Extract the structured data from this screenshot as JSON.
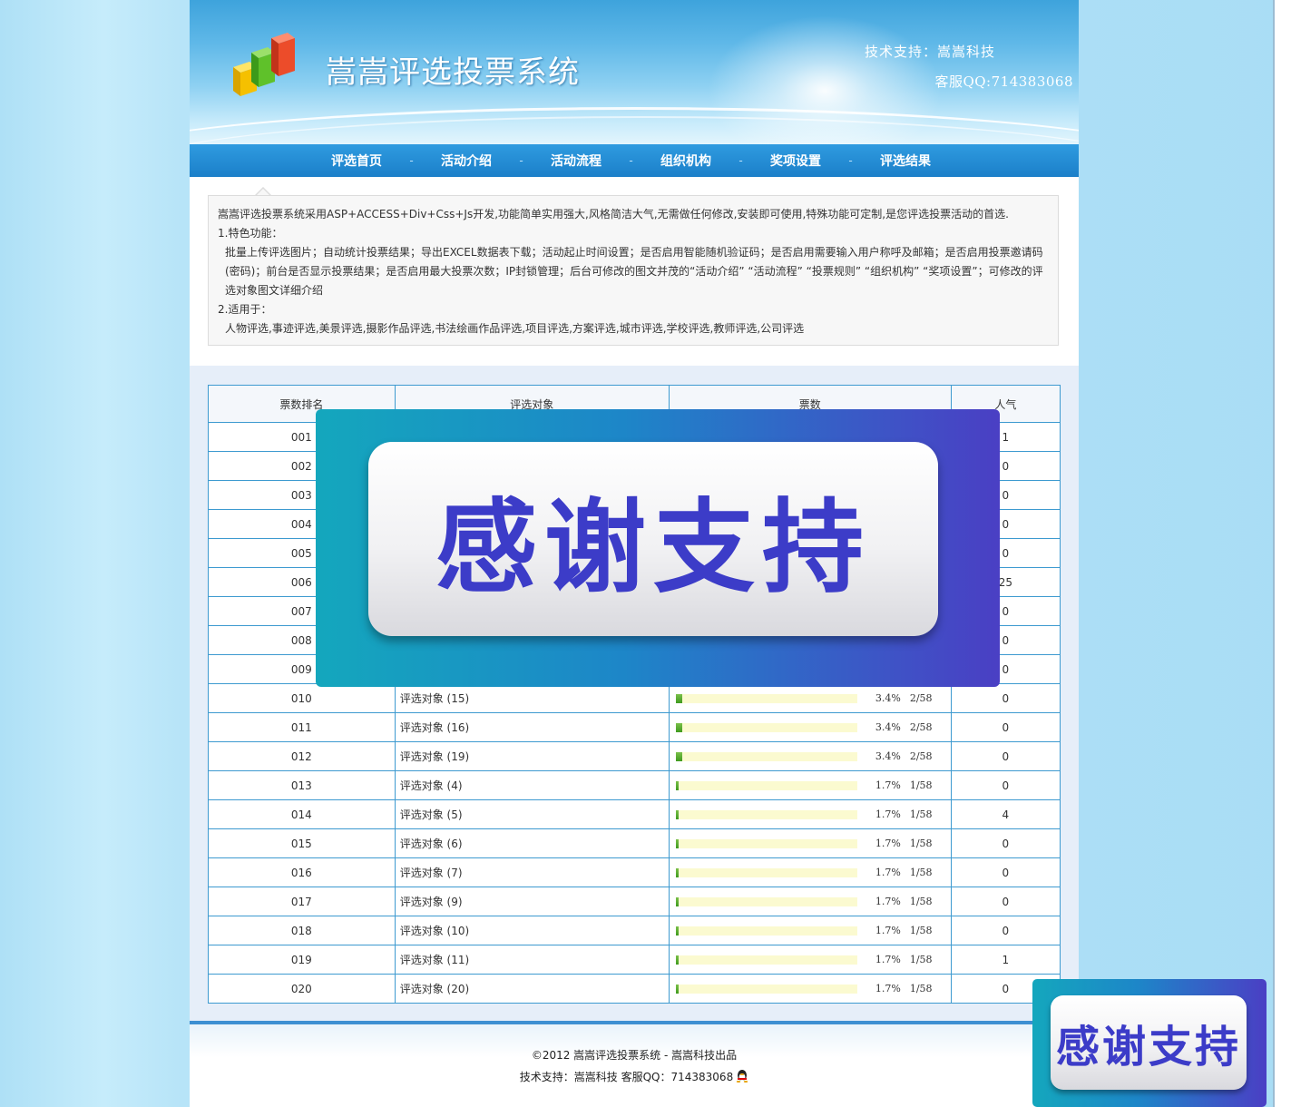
{
  "header": {
    "site_title": "嵩嵩评选投票系统",
    "support": "技术支持：嵩嵩科技",
    "qq": "客服QQ:714383068"
  },
  "nav": {
    "items": [
      "评选首页",
      "活动介绍",
      "活动流程",
      "组织机构",
      "奖项设置",
      "评选结果"
    ],
    "separator": "-"
  },
  "intro": {
    "line1": "嵩嵩评选投票系统采用ASP+ACCESS+Div+Css+Js开发,功能简单实用强大,风格简洁大气,无需做任何修改,安装即可使用,特殊功能可定制,是您评选投票活动的首选.",
    "line2": "1.特色功能：",
    "line3": "批量上传评选图片；自动统计投票结果；导出EXCEL数据表下载；活动起止时间设置；是否启用智能随机验证码；是否启用需要输入用户称呼及邮箱；是否启用投票邀请码(密码)；前台是否显示投票结果；是否启用最大投票次数；IP封锁管理；后台可修改的图文并茂的“活动介绍” “活动流程” “投票规则” “组织机构” “奖项设置”；可修改的评选对象图文详细介绍",
    "line4": "2.适用于：",
    "line5": "人物评选,事迹评选,美景评选,摄影作品评选,书法绘画作品评选,项目评选,方案评选,城市评选,学校评选,教师评选,公司评选"
  },
  "table": {
    "headers": {
      "rank": "票数排名",
      "name": "评选对象",
      "votes": "票数",
      "popularity": "人气"
    },
    "rows": [
      {
        "rank": "001",
        "name": "",
        "pct": "",
        "frac": "",
        "pop": "1",
        "fill": 0
      },
      {
        "rank": "002",
        "name": "",
        "pct": "",
        "frac": "",
        "pop": "0",
        "fill": 0
      },
      {
        "rank": "003",
        "name": "",
        "pct": "",
        "frac": "",
        "pop": "0",
        "fill": 0
      },
      {
        "rank": "004",
        "name": "",
        "pct": "",
        "frac": "",
        "pop": "0",
        "fill": 0
      },
      {
        "rank": "005",
        "name": "",
        "pct": "",
        "frac": "",
        "pop": "0",
        "fill": 0
      },
      {
        "rank": "006",
        "name": "",
        "pct": "",
        "frac": "",
        "pop": "25",
        "fill": 0
      },
      {
        "rank": "007",
        "name": "",
        "pct": "",
        "frac": "",
        "pop": "0",
        "fill": 0
      },
      {
        "rank": "008",
        "name": "",
        "pct": "",
        "frac": "",
        "pop": "0",
        "fill": 0
      },
      {
        "rank": "009",
        "name": "",
        "pct": "",
        "frac": "",
        "pop": "0",
        "fill": 0
      },
      {
        "rank": "010",
        "name": "评选对象 (15)",
        "pct": "3.4%",
        "frac": "2/58",
        "pop": "0",
        "fill": 3.4
      },
      {
        "rank": "011",
        "name": "评选对象 (16)",
        "pct": "3.4%",
        "frac": "2/58",
        "pop": "0",
        "fill": 3.4
      },
      {
        "rank": "012",
        "name": "评选对象 (19)",
        "pct": "3.4%",
        "frac": "2/58",
        "pop": "0",
        "fill": 3.4
      },
      {
        "rank": "013",
        "name": "评选对象 (4)",
        "pct": "1.7%",
        "frac": "1/58",
        "pop": "0",
        "fill": 1.7
      },
      {
        "rank": "014",
        "name": "评选对象 (5)",
        "pct": "1.7%",
        "frac": "1/58",
        "pop": "4",
        "fill": 1.7
      },
      {
        "rank": "015",
        "name": "评选对象 (6)",
        "pct": "1.7%",
        "frac": "1/58",
        "pop": "0",
        "fill": 1.7
      },
      {
        "rank": "016",
        "name": "评选对象 (7)",
        "pct": "1.7%",
        "frac": "1/58",
        "pop": "0",
        "fill": 1.7
      },
      {
        "rank": "017",
        "name": "评选对象 (9)",
        "pct": "1.7%",
        "frac": "1/58",
        "pop": "0",
        "fill": 1.7
      },
      {
        "rank": "018",
        "name": "评选对象 (10)",
        "pct": "1.7%",
        "frac": "1/58",
        "pop": "0",
        "fill": 1.7
      },
      {
        "rank": "019",
        "name": "评选对象 (11)",
        "pct": "1.7%",
        "frac": "1/58",
        "pop": "1",
        "fill": 1.7
      },
      {
        "rank": "020",
        "name": "评选对象 (20)",
        "pct": "1.7%",
        "frac": "1/58",
        "pop": "0",
        "fill": 1.7
      }
    ]
  },
  "footer": {
    "copyright": "©2012 嵩嵩评选投票系统 - 嵩嵩科技出品",
    "contact": "技术支持：嵩嵩科技 客服QQ：714383068"
  },
  "popups": {
    "big_text": "感谢支持",
    "small_text": "感谢支持"
  },
  "colors": {
    "nav_bg": "#1b7fc9",
    "table_border": "#3d9ad0",
    "bar_fill": "#4fa82b",
    "bar_track": "#fbfad0",
    "popup_text": "#3c3cc8"
  }
}
